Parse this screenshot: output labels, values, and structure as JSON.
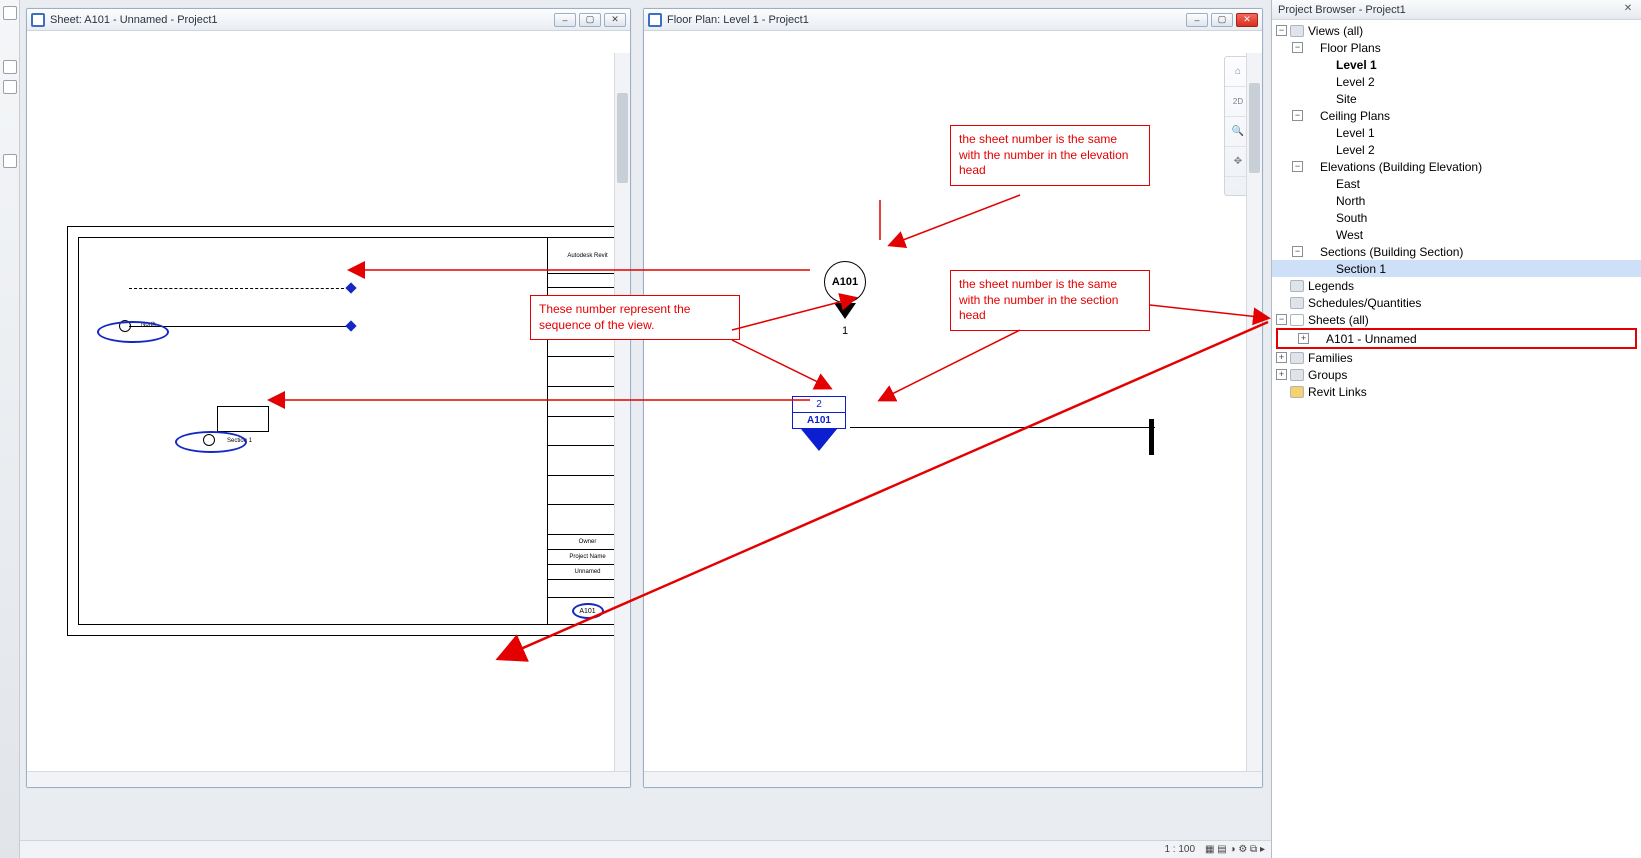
{
  "leftWindow": {
    "title": "Sheet: A101 - Unnamed - Project1",
    "titleBlock": {
      "company": "Autodesk Revit",
      "owner": "Owner",
      "projectName": "Project Name",
      "sheetName": "Unnamed",
      "sheetNumber": "A101"
    },
    "annotations": {
      "northLabel": "North",
      "sectionLabel": "Section 1"
    }
  },
  "rightWindow": {
    "title": "Floor Plan: Level 1 - Project1",
    "elevationHead": {
      "sheet": "A101",
      "sequence": "1"
    },
    "sectionHead": {
      "sheet": "A101",
      "sequence": "2"
    },
    "statusScale": "1 : 100"
  },
  "callouts": {
    "co1": "These number represent the sequence of the view.",
    "co2": "the sheet number is the same with the number in the section head",
    "co3": "the sheet number is the same with the number in the elevation head"
  },
  "projectBrowser": {
    "title": "Project Browser - Project1",
    "tree": {
      "viewsAll": "Views (all)",
      "floorPlans": "Floor Plans",
      "level1": "Level 1",
      "level2": "Level 2",
      "site": "Site",
      "ceilingPlans": "Ceiling Plans",
      "cpLevel1": "Level 1",
      "cpLevel2": "Level 2",
      "elevations": "Elevations (Building Elevation)",
      "east": "East",
      "north": "North",
      "south": "South",
      "west": "West",
      "sections": "Sections (Building Section)",
      "section1": "Section 1",
      "legends": "Legends",
      "schedules": "Schedules/Quantities",
      "sheetsAll": "Sheets (all)",
      "sheetA101": "A101 - Unnamed",
      "families": "Families",
      "groups": "Groups",
      "revitLinks": "Revit Links"
    }
  }
}
